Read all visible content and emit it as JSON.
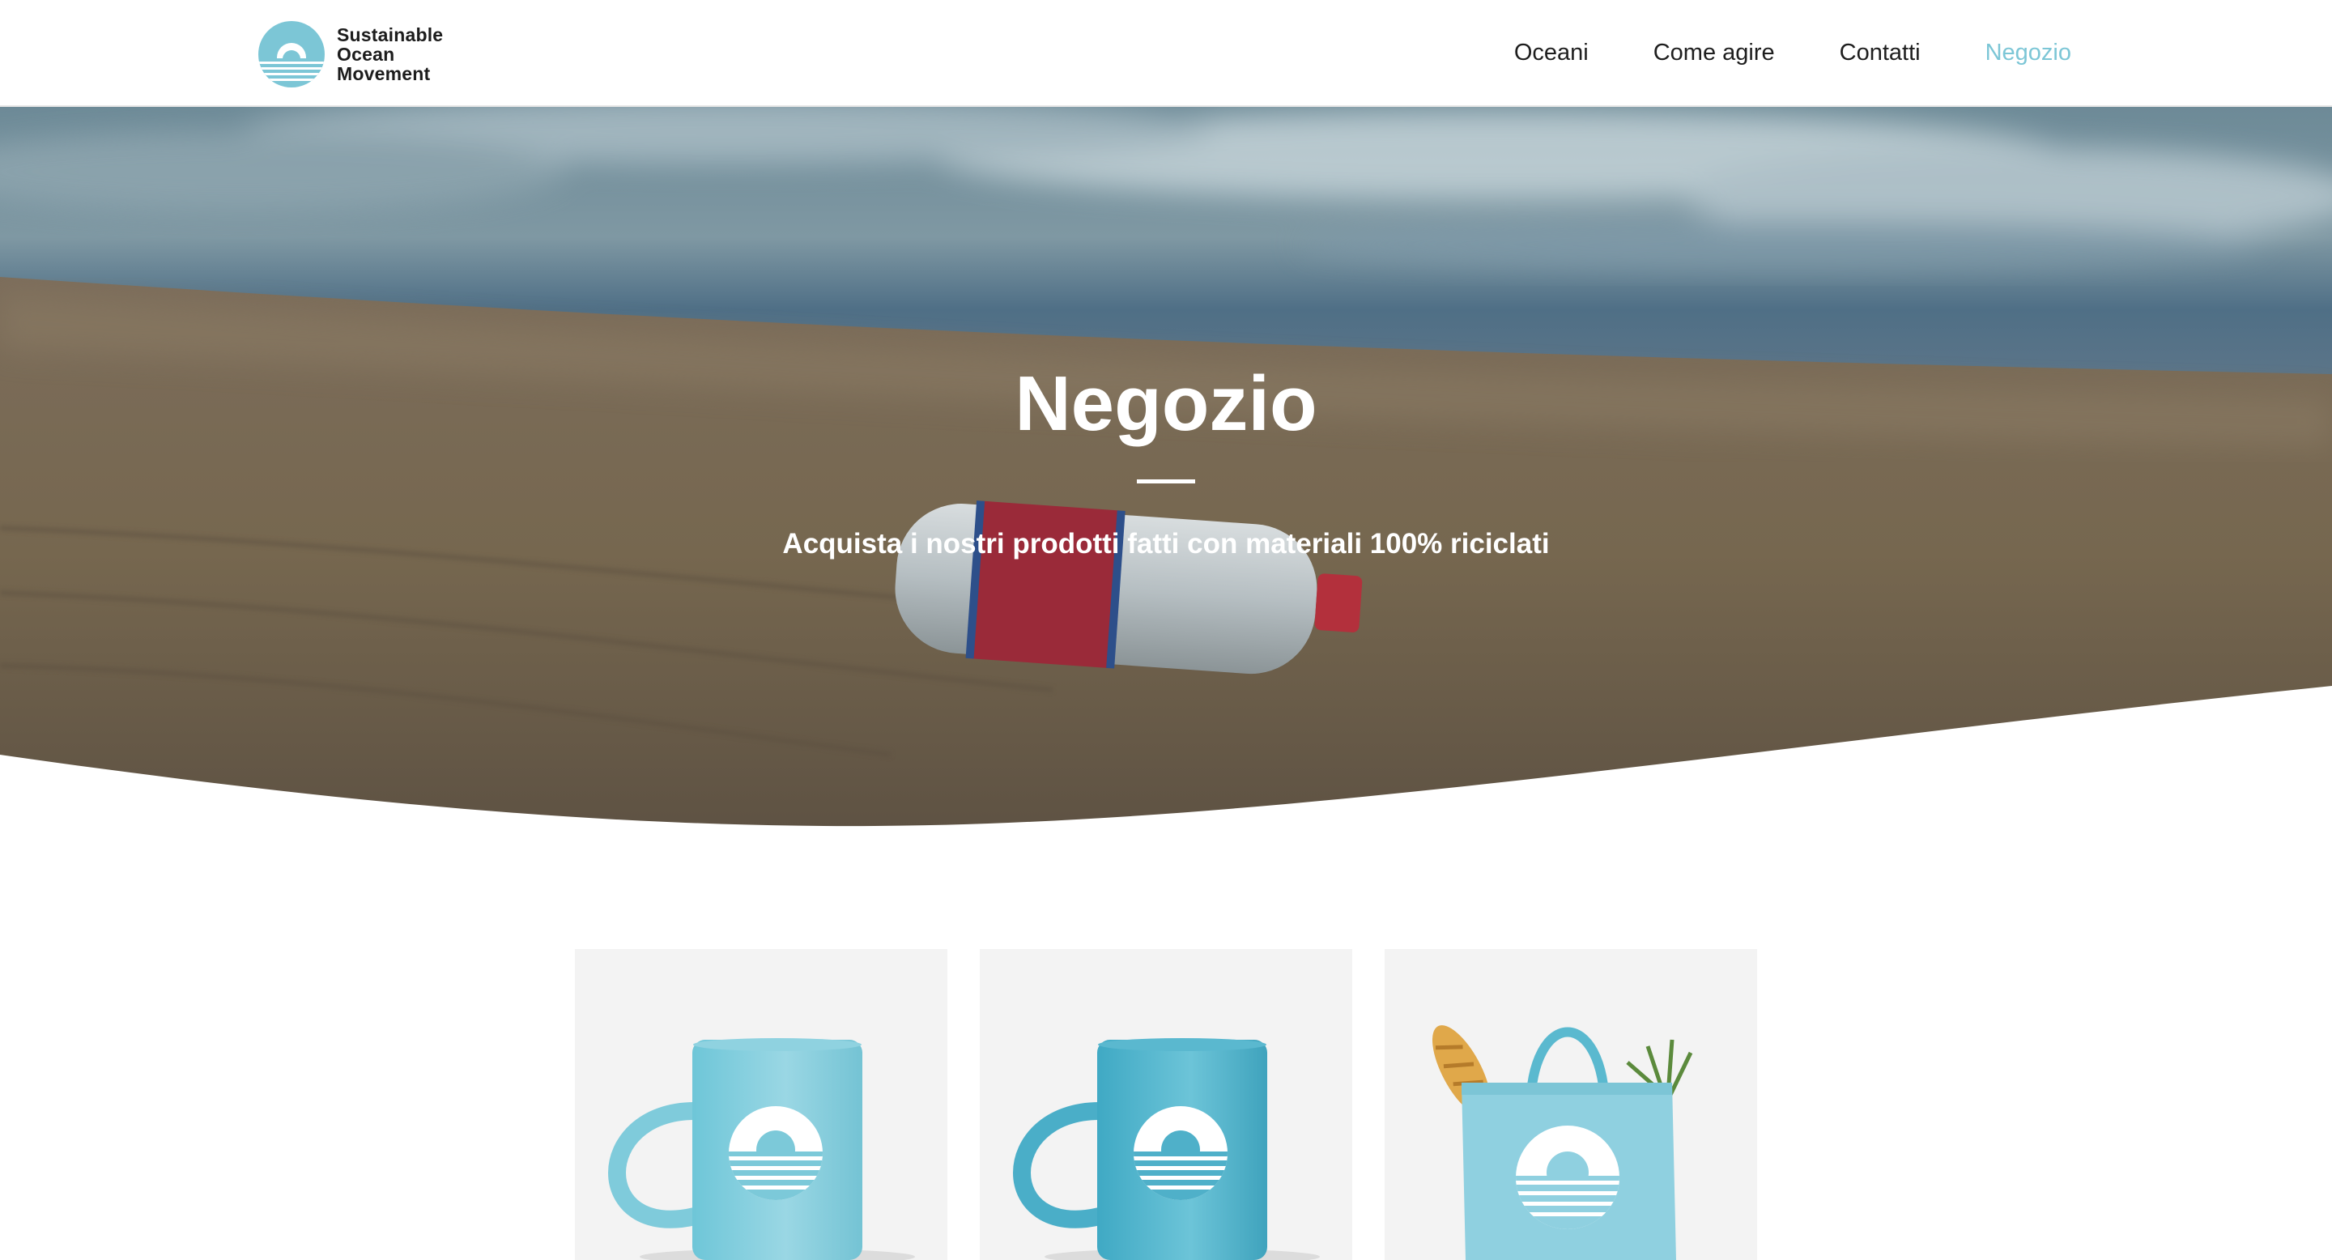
{
  "brand": {
    "line1": "Sustainable",
    "line2": "Ocean",
    "line3": "Movement",
    "logo_icon": "sunset-over-waves-icon",
    "color": "#7cc6d6"
  },
  "nav": {
    "items": [
      {
        "label": "Oceani"
      },
      {
        "label": "Come agire"
      },
      {
        "label": "Contatti"
      },
      {
        "label": "Negozio",
        "active": true
      }
    ],
    "active_color": "#7cc6d6"
  },
  "hero": {
    "title": "Negozio",
    "subtitle": "Acquista i nostri prodotti fatti con materiali 100% riciclati",
    "image": "plastic-bottle-on-beach-photo"
  },
  "products": [
    {
      "image": "light-blue-mug-with-logo"
    },
    {
      "image": "blue-mug-with-logo"
    },
    {
      "image": "tote-bag-with-logo"
    }
  ],
  "colors": {
    "accent": "#7cc6d6",
    "product_blue": "#5fc3d8",
    "text": "#1e1e1e"
  }
}
